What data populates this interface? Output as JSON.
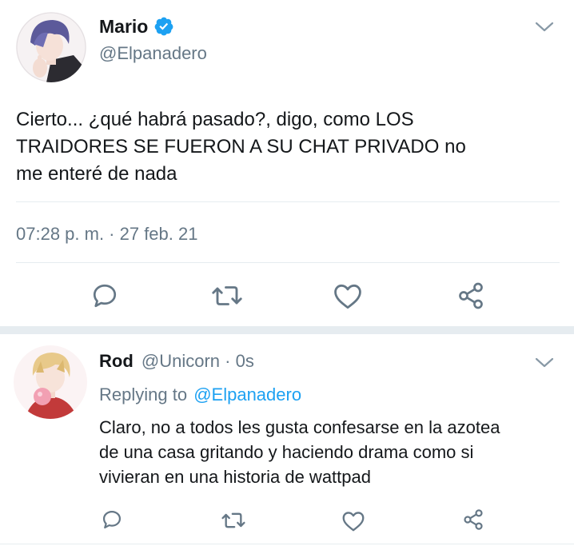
{
  "main_tweet": {
    "author_name": "Mario",
    "verified_icon": "verified-badge-icon",
    "handle": "@Elpanadero",
    "text_lines": [
      "Cierto... ¿qué habrá pasado?, digo, como LOS",
      "TRAIDORES SE FUERON A SU CHAT PRIVADO no",
      "me enteré de nada"
    ],
    "timestamp": "07:28 p. m. · 27 feb. 21",
    "actions": [
      "reply-icon",
      "retweet-icon",
      "like-icon",
      "share-icon"
    ]
  },
  "reply_tweet": {
    "author_name": "Rod",
    "handle_time": "@Unicorn · 0s",
    "replying_prefix": "Replying to",
    "replying_handle": "@Elpanadero",
    "text_lines": [
      "Claro, no a todos les gusta confesarse en la azotea",
      "de una casa gritando y haciendo drama como si",
      "vivieran en una historia de wattpad"
    ],
    "actions": [
      "reply-icon",
      "retweet-icon",
      "like-icon",
      "share-icon"
    ]
  },
  "colors": {
    "accent": "#1da1f2",
    "text": "#14171a",
    "secondary": "#657786",
    "divider": "#e6ecf0"
  }
}
